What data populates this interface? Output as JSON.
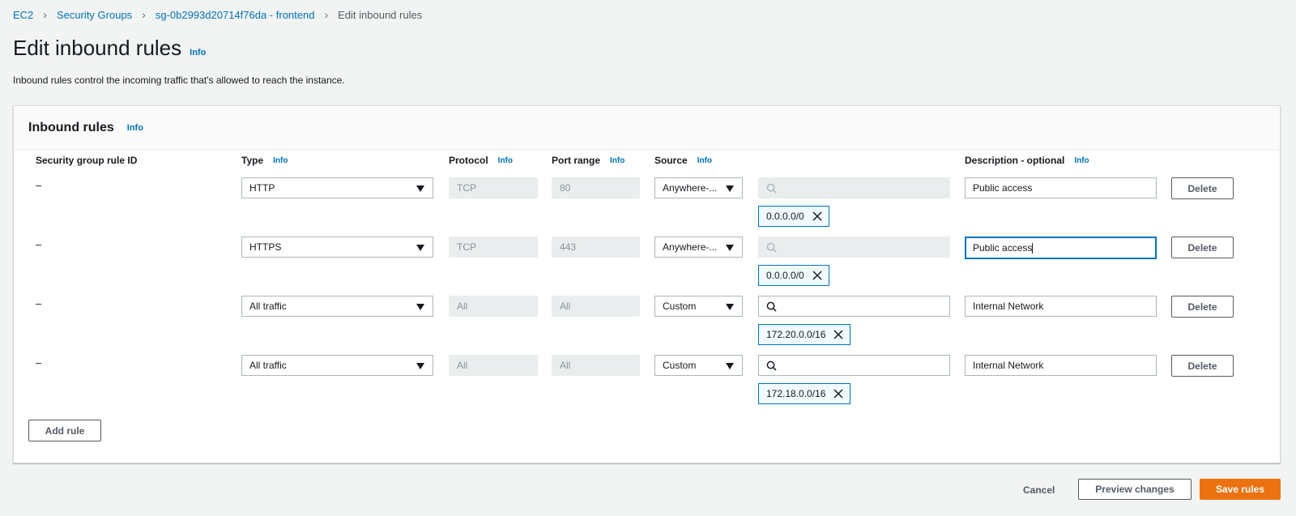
{
  "breadcrumb": {
    "items": [
      "EC2",
      "Security Groups",
      "sg-0b2993d20714f76da - frontend"
    ],
    "current": "Edit inbound rules"
  },
  "page": {
    "title": "Edit inbound rules",
    "info": "Info",
    "description": "Inbound rules control the incoming traffic that's allowed to reach the instance."
  },
  "panel": {
    "title": "Inbound rules",
    "info": "Info",
    "columns": {
      "rule_id": "Security group rule ID",
      "type": "Type",
      "protocol": "Protocol",
      "port_range": "Port range",
      "source": "Source",
      "description": "Description - optional"
    },
    "info_label": "Info"
  },
  "rules": [
    {
      "rule_id": "–",
      "type": "HTTP",
      "protocol": "TCP",
      "port_range": "80",
      "source": "Anywhere-...",
      "source_token": "0.0.0.0/0",
      "description": "Public access",
      "delete": "Delete"
    },
    {
      "rule_id": "–",
      "type": "HTTPS",
      "protocol": "TCP",
      "port_range": "443",
      "source": "Anywhere-...",
      "source_token": "0.0.0.0/0",
      "description": "Public access",
      "delete": "Delete"
    },
    {
      "rule_id": "–",
      "type": "All traffic",
      "protocol": "All",
      "port_range": "All",
      "source": "Custom",
      "source_token": "172.20.0.0/16",
      "description": "Internal Network",
      "delete": "Delete"
    },
    {
      "rule_id": "–",
      "type": "All traffic",
      "protocol": "All",
      "port_range": "All",
      "source": "Custom",
      "source_token": "172.18.0.0/16",
      "description": "Internal Network",
      "delete": "Delete"
    }
  ],
  "actions": {
    "add_rule": "Add rule",
    "cancel": "Cancel",
    "preview": "Preview changes",
    "save": "Save rules"
  },
  "colors": {
    "link": "#0073bb",
    "primary": "#ec7211",
    "background": "#f2f3f3"
  }
}
